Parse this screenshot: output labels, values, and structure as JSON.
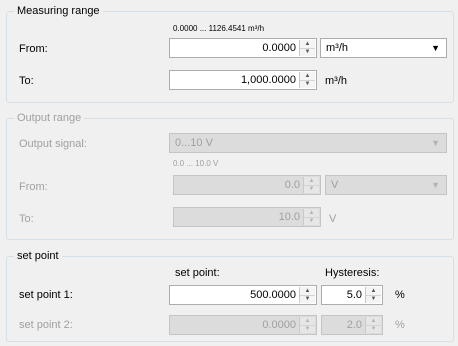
{
  "measuring_range": {
    "title": "Measuring range",
    "hint": "0.0000 ... 1126.4541 m³/h",
    "from_label": "From:",
    "from_value": "0.0000",
    "unit_select": "m³/h",
    "to_label": "To:",
    "to_value": "1,000.0000",
    "to_unit": "m³/h"
  },
  "output_range": {
    "title": "Output range",
    "signal_label": "Output signal:",
    "signal_value": "0...10 V",
    "hint": "0.0 ... 10.0 V",
    "from_label": "From:",
    "from_value": "0.0",
    "from_unit": "V",
    "to_label": "To:",
    "to_value": "10.0",
    "to_unit": "V"
  },
  "set_point": {
    "title": "set point",
    "col_setpoint": "set point:",
    "col_hysteresis": "Hysteresis:",
    "sp1_label": "set point 1:",
    "sp1_value": "500.0000",
    "sp1_hyst": "5.0",
    "sp1_unit": "%",
    "sp2_label": "set point 2:",
    "sp2_value": "0.0000",
    "sp2_hyst": "2.0",
    "sp2_unit": "%"
  },
  "icons": {
    "spin_up": "▲",
    "spin_down": "▼",
    "dropdown": "▼"
  }
}
